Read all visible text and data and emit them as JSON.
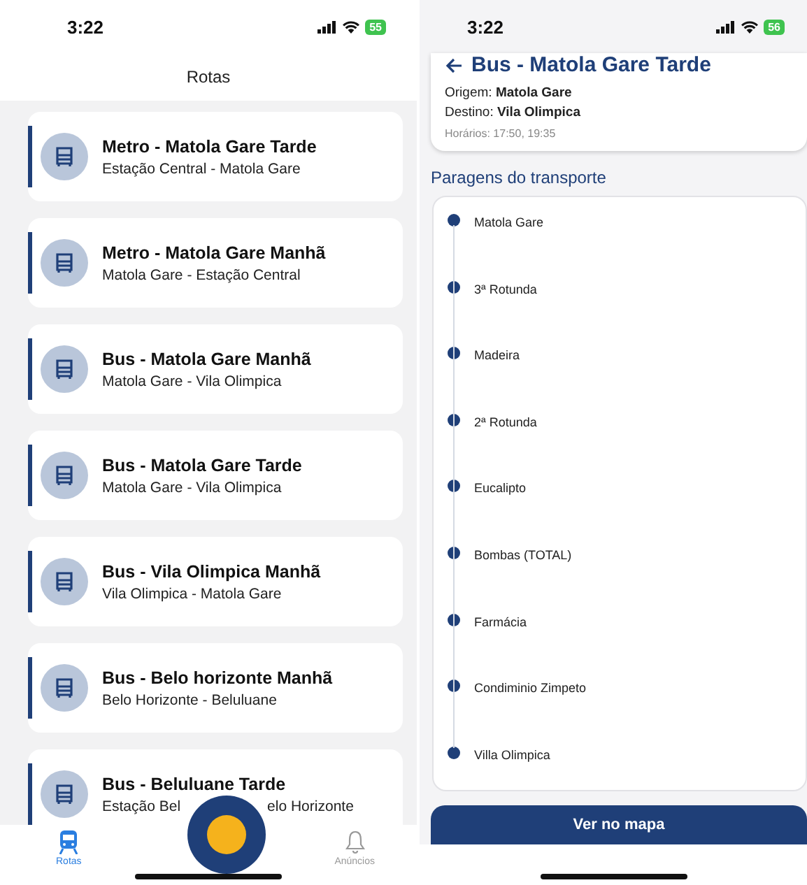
{
  "left_screen": {
    "status_bar": {
      "time": "3:22",
      "battery": "55"
    },
    "title": "Rotas",
    "routes": [
      {
        "title": "Metro - Matola Gare Tarde",
        "subtitle": "Estação Central - Matola Gare"
      },
      {
        "title": "Metro - Matola Gare Manhã",
        "subtitle": "Matola Gare - Estação Central"
      },
      {
        "title": "Bus - Matola Gare Manhã",
        "subtitle": "Matola Gare - Vila Olimpica"
      },
      {
        "title": "Bus - Matola Gare Tarde",
        "subtitle": "Matola Gare - Vila Olimpica"
      },
      {
        "title": "Bus - Vila Olimpica Manhã",
        "subtitle": "Vila Olimpica - Matola Gare"
      },
      {
        "title": "Bus - Belo horizonte Manhã",
        "subtitle": "Belo Horizonte - Beluluane"
      },
      {
        "title": "Bus - Beluluane Tarde",
        "subtitle_parts": [
          "Estação Bel",
          "elo Horizonte"
        ]
      }
    ],
    "tabs": [
      {
        "label": "Rotas",
        "selected": true,
        "kind": "train"
      },
      {
        "label": "Anúncios",
        "selected": false,
        "kind": "bell"
      }
    ]
  },
  "right_screen": {
    "status_bar": {
      "time": "3:22",
      "battery": "56"
    },
    "title": "Bus - Matola Gare Tarde",
    "details": [
      "Origem: **Matola Gare**",
      "Destino: **Vila Olimpica**"
    ],
    "schedule": "Horários: 17:50, 19:35",
    "stops_title": "Paragens do transporte",
    "stops": [
      "Matola Gare",
      "3ª Rotunda",
      "Madeira",
      "2ª Rotunda",
      "Eucalipto",
      "Bombas (TOTAL)",
      "Farmácia",
      "Condiminio Zimpeto",
      "Villa Olimpica"
    ],
    "map_button": "Ver no mapa"
  }
}
